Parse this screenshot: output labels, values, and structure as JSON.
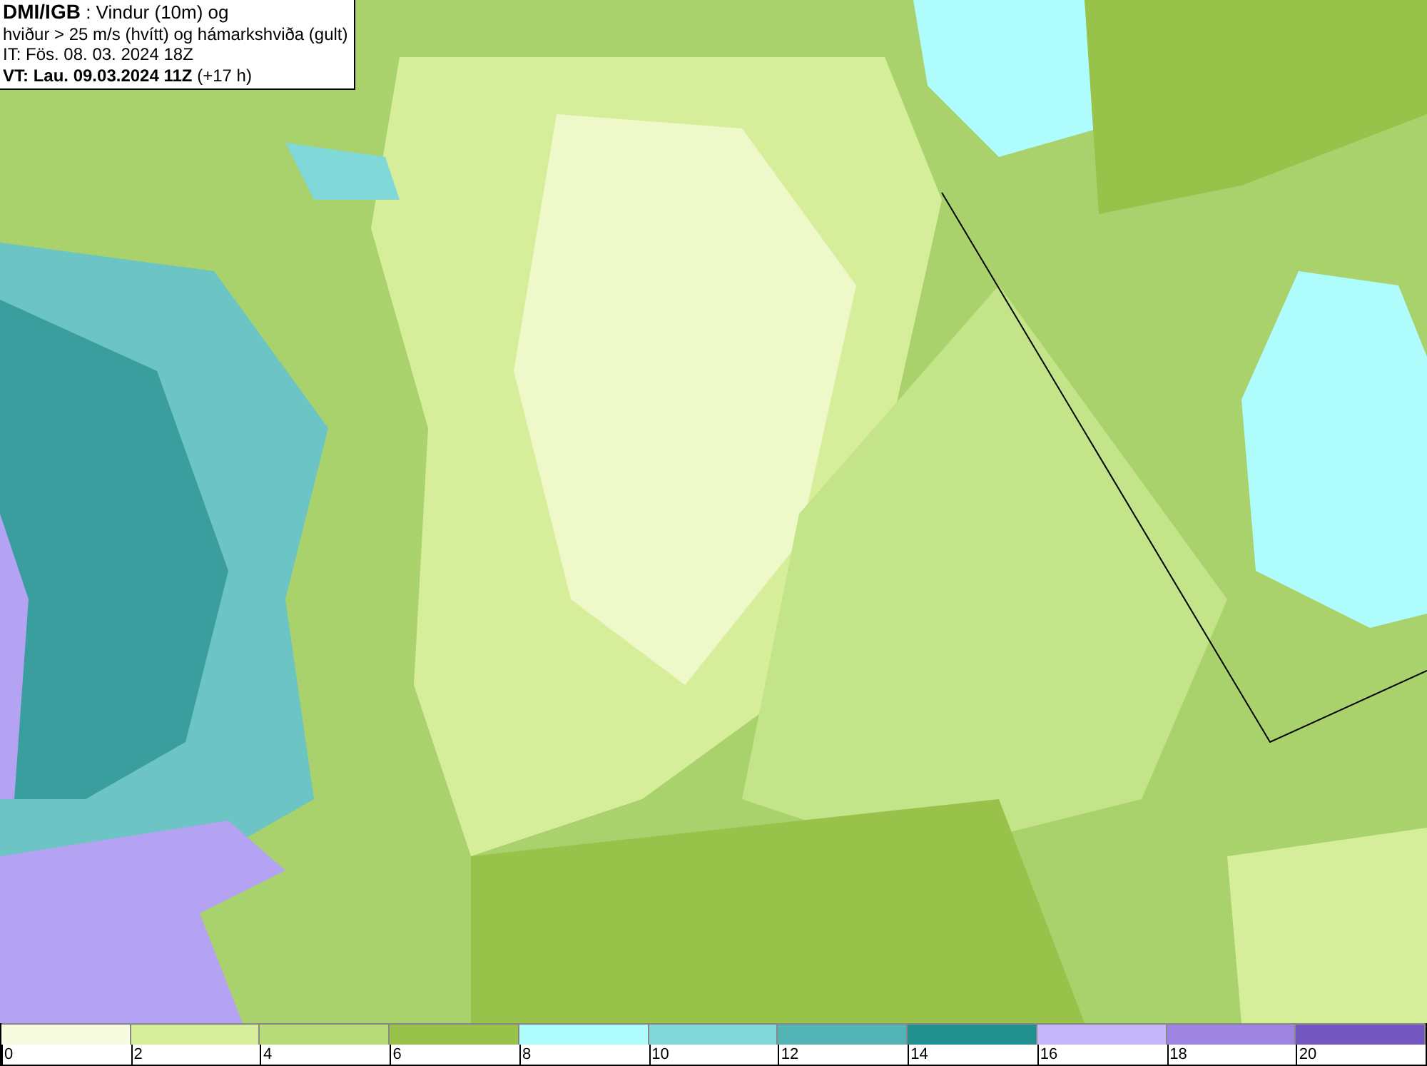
{
  "header": {
    "lines": [
      "**DMI/IGB** : Vindur (10m) og",
      "hviður > 25 m/s (hvítt) og hámarkshviða (gult)",
      "IT: Fös. 08. 03. 2024 18Z",
      "**VT: Lau. 09.03.2024 11Z** (+17 h)"
    ]
  },
  "legend": [
    {
      "label": "0",
      "color": "#f7fbe0"
    },
    {
      "label": "2",
      "color": "#d6ee9a"
    },
    {
      "label": "4",
      "color": "#b8dc78"
    },
    {
      "label": "6",
      "color": "#98c24a"
    },
    {
      "label": "8",
      "color": "#aefcfc"
    },
    {
      "label": "10",
      "color": "#80d8d8"
    },
    {
      "label": "12",
      "color": "#52b4b4"
    },
    {
      "label": "14",
      "color": "#239090"
    },
    {
      "label": "16",
      "color": "#c4b4fa"
    },
    {
      "label": "18",
      "color": "#9c84e0"
    },
    {
      "label": "20",
      "color": "#7456c0"
    }
  ]
}
